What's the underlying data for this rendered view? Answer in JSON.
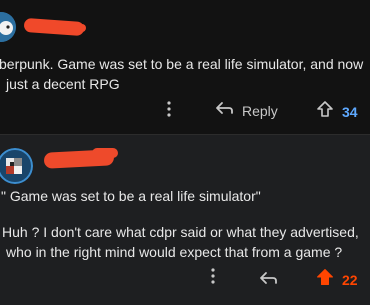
{
  "comment1": {
    "body_line1": "berpunk. Game was set to be a real life simulator, and now",
    "body_line2": "just a decent RPG",
    "reply_label": "Reply",
    "score": "34",
    "score_color": "#5ea9ff"
  },
  "comment2": {
    "body_line1": "\" Game was set to be a real life simulator\"",
    "body_line2": "Huh ? I don't care what cdpr said or what they advertised,",
    "body_line3": "who in the right mind would expect that from a game ?",
    "score": "22",
    "score_color": "#ff4500"
  },
  "icons": {
    "more": "more-vertical-icon",
    "reply": "reply-arrow-icon",
    "upvote": "upvote-arrow-icon"
  },
  "colors": {
    "background": "#121212",
    "comment2_background": "#1e1f21",
    "redaction": "#f0492a"
  }
}
